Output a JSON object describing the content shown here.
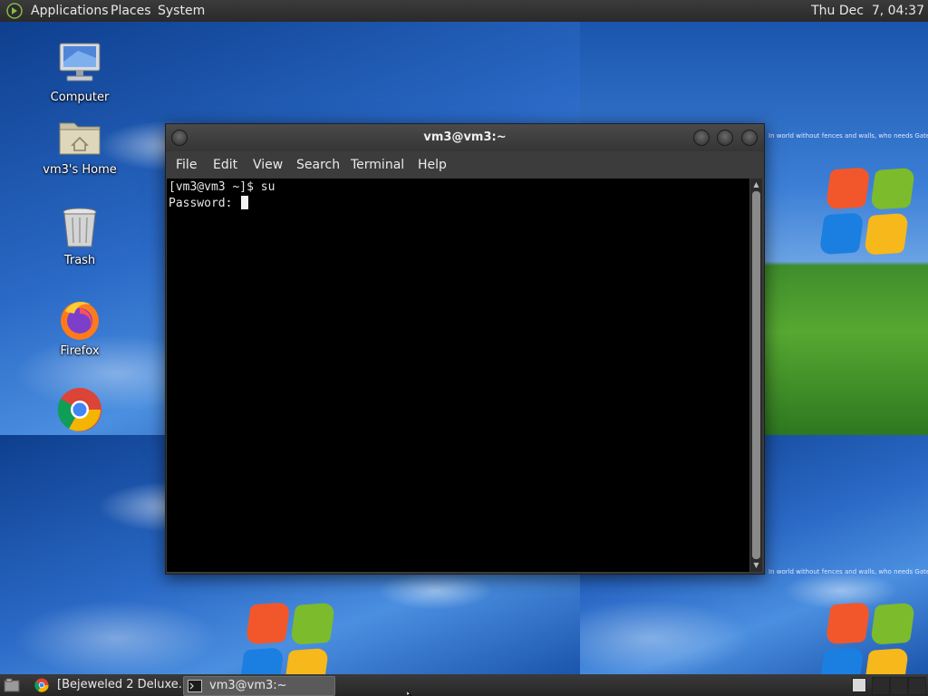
{
  "top_panel": {
    "menus": [
      "Applications",
      "Places",
      "System"
    ],
    "clock": "Thu Dec  7, 04:37"
  },
  "wallpaper": {
    "caption": "In world without fences and walls, who needs Gates a",
    "caption_small": "In world without fences and walls, who needs Gates a"
  },
  "desktop_icons": [
    {
      "label": "Computer",
      "icon": "computer-icon"
    },
    {
      "label": "vm3's Home",
      "icon": "home-folder-icon"
    },
    {
      "label": "Trash",
      "icon": "trash-icon"
    },
    {
      "label": "Firefox",
      "icon": "firefox-icon"
    },
    {
      "label": "",
      "icon": "chrome-icon"
    }
  ],
  "terminal": {
    "title": "vm3@vm3:~",
    "menu": [
      "File",
      "Edit",
      "View",
      "Search",
      "Terminal",
      "Help"
    ],
    "lines": [
      "[vm3@vm3 ~]$ su",
      "Password: "
    ]
  },
  "bottom_panel": {
    "tasks": [
      {
        "label": "[Bejeweled 2 Deluxe...",
        "icon": "chrome-icon",
        "active": false
      },
      {
        "label": "vm3@vm3:~",
        "icon": "terminal-icon",
        "active": true
      }
    ]
  },
  "colors": {
    "panel": "#2f2f2f",
    "terminal_bg": "#000000",
    "terminal_fg": "#e6e6e6"
  }
}
